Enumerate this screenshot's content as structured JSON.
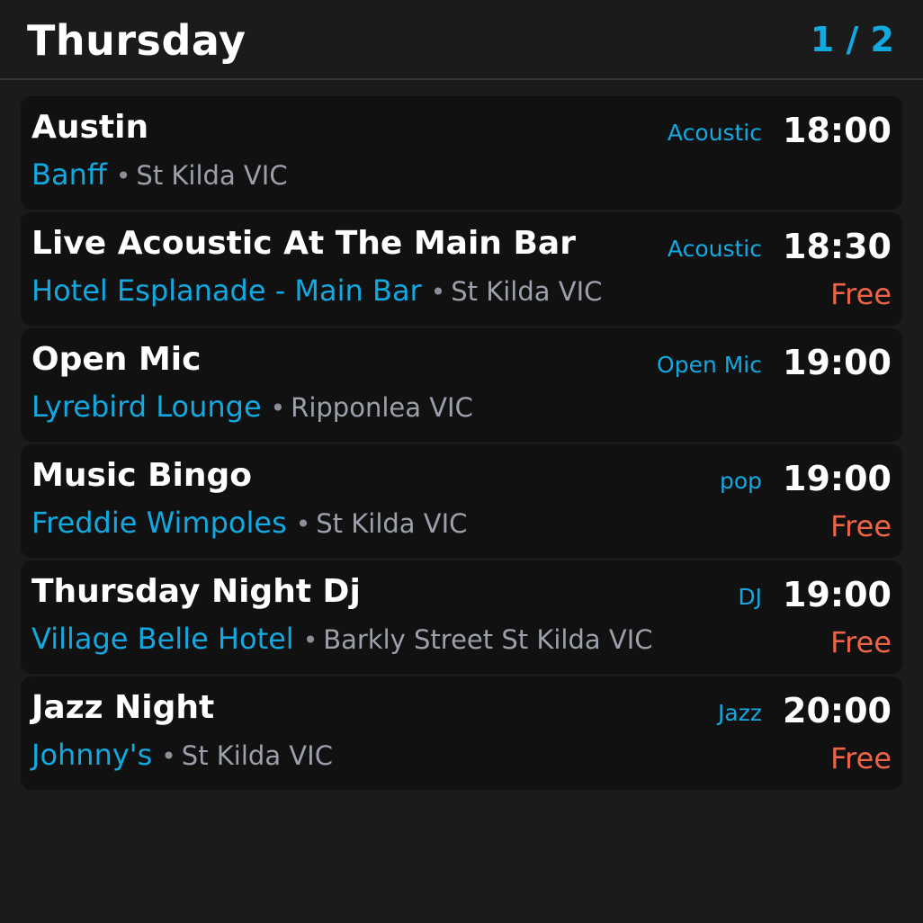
{
  "header": {
    "title": "Thursday",
    "page_indicator": "1 / 2"
  },
  "events": [
    {
      "title": "Austin",
      "genre": "Acoustic",
      "time": "18:00",
      "venue": "Banff",
      "bullet": "•",
      "location": "St Kilda VIC",
      "price": ""
    },
    {
      "title": "Live Acoustic At The Main Bar",
      "genre": "Acoustic",
      "time": "18:30",
      "venue": "Hotel Esplanade - Main Bar",
      "bullet": "•",
      "location": "St Kilda VIC",
      "price": "Free"
    },
    {
      "title": "Open Mic",
      "genre": "Open Mic",
      "time": "19:00",
      "venue": "Lyrebird Lounge",
      "bullet": "•",
      "location": "Ripponlea VIC",
      "price": ""
    },
    {
      "title": "Music Bingo",
      "genre": "pop",
      "time": "19:00",
      "venue": "Freddie Wimpoles",
      "bullet": "•",
      "location": "St Kilda VIC",
      "price": "Free"
    },
    {
      "title": "Thursday Night Dj",
      "genre": "DJ",
      "time": "19:00",
      "venue": "Village Belle Hotel",
      "bullet": "•",
      "location": "Barkly Street St Kilda VIC",
      "price": "Free"
    },
    {
      "title": "Jazz Night",
      "genre": "Jazz",
      "time": "20:00",
      "venue": "Johnny's",
      "bullet": "•",
      "location": "St Kilda VIC",
      "price": "Free"
    }
  ],
  "colors": {
    "background": "#1b1b1b",
    "card": "#111111",
    "accent": "#12a8e0",
    "price": "#ee6448",
    "location": "#9ba0aa"
  }
}
